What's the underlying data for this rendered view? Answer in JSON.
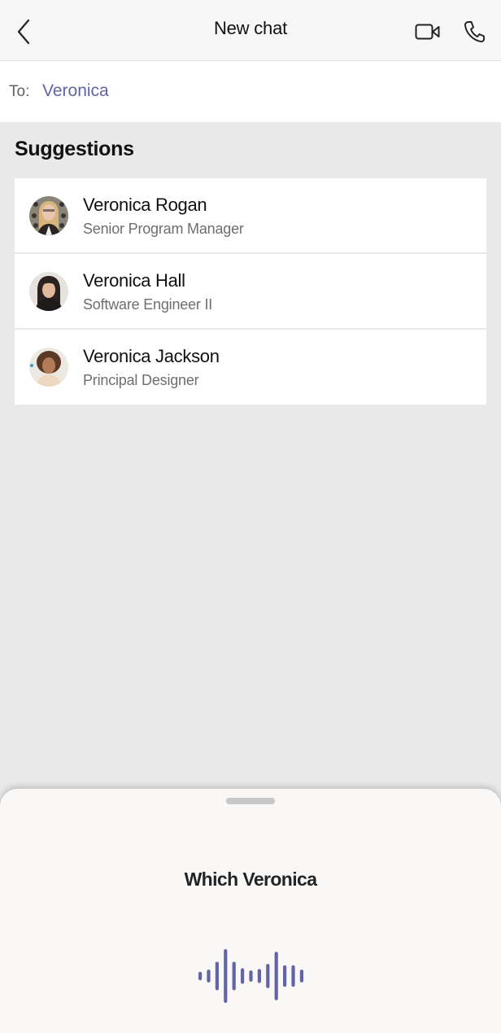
{
  "header": {
    "title": "New chat",
    "back_icon": "chevron-left-icon",
    "video_icon": "video-camera-icon",
    "call_icon": "phone-icon"
  },
  "to_field": {
    "label": "To:",
    "value": "Veronica"
  },
  "suggestions": {
    "title": "Suggestions",
    "items": [
      {
        "name": "Veronica Rogan",
        "role": "Senior Program Manager",
        "avatar": "avatar-photo"
      },
      {
        "name": "Veronica Hall",
        "role": "Software Engineer II",
        "avatar": "avatar-photo"
      },
      {
        "name": "Veronica Jackson",
        "role": "Principal Designer",
        "avatar": "avatar-photo"
      }
    ]
  },
  "voice_sheet": {
    "prompt": "Which Veronica",
    "waveform_icon": "voice-waveform-icon",
    "waveform_levels": [
      0.16,
      0.24,
      0.53,
      1.0,
      0.53,
      0.29,
      0.21,
      0.26,
      0.45,
      0.9,
      0.4,
      0.4,
      0.24
    ]
  },
  "colors": {
    "accent": "#6264a7",
    "background": "#e9e9e9",
    "header_bg": "#f7f7f7",
    "sheet_bg": "#f9f8f7"
  }
}
